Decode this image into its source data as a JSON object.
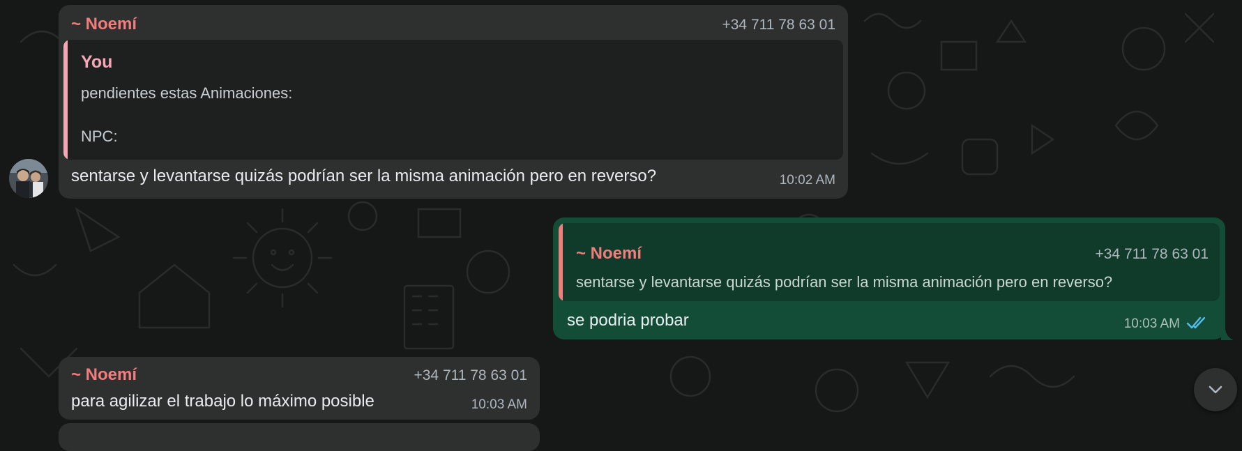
{
  "messages": [
    {
      "direction": "incoming",
      "sender": "~ Noemí",
      "phone": "+34 711 78 63 01",
      "quote": {
        "author": "You",
        "lines": [
          "pendientes estas Animaciones:",
          "NPC:"
        ]
      },
      "text": "sentarse y levantarse quizás podrían ser la misma animación pero en reverso?",
      "time": "10:02 AM"
    },
    {
      "direction": "outgoing",
      "quote": {
        "author": "~ Noemí",
        "phone": "+34 711 78 63 01",
        "text": "sentarse y levantarse quizás podrían ser la misma animación pero en reverso?"
      },
      "text": "se podria probar",
      "time": "10:03 AM",
      "status_icon": "double-check-read-icon"
    },
    {
      "direction": "incoming",
      "sender": "~ Noemí",
      "phone": "+34 711 78 63 01",
      "text": "para agilizar el trabajo lo máximo posible",
      "time": "10:03 AM"
    }
  ],
  "colors": {
    "background": "#161717",
    "incoming_bubble": "#2e2f2f",
    "outgoing_bubble": "#144d37",
    "sender_name": "#f27d7c",
    "quote_you": "#f7a6b5",
    "read_ticks": "#53bdeb"
  },
  "icons": {
    "avatar": "user-avatar",
    "scroll_down": "chevron-down-icon"
  }
}
